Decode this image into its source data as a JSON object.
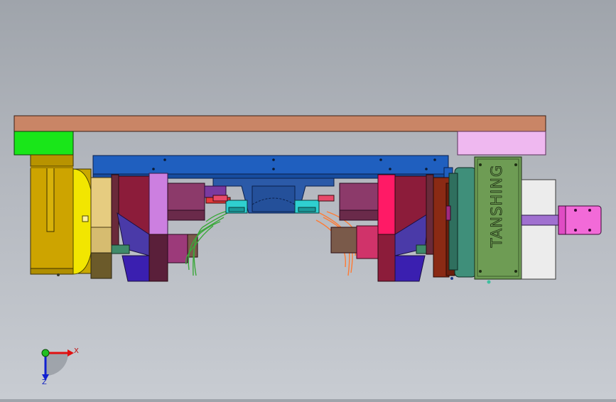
{
  "viewport": {
    "background_top": "#9fa4ab",
    "background_bottom": "#c8ccd2"
  },
  "model": {
    "brand_text": "TANSHING",
    "colors": {
      "top_plate": "#c98566",
      "green_block": "#19e619",
      "pink_block": "#efb8f0",
      "blue_beam": "#1f5fbf",
      "gold_drum": "#cda400",
      "yellow_ring": "#f2e600",
      "dark_red": "#8c1c3a",
      "magenta": "#ff1a66",
      "violet": "#cc7fe0",
      "indigo": "#3a1fb0",
      "green_motor": "#4f8f3f",
      "motor_body": "#6e9c54",
      "gray_block": "#ececec",
      "purple_shaft": "#a070d0",
      "pink_coupling": "#f26ad8",
      "teal_ring": "#3f8f7a",
      "orange_wire": "#ff7a33",
      "green_wire": "#3aa83a"
    }
  },
  "triad": {
    "x_label": "X",
    "z_label": "Z",
    "icon": "coordinate-triad-icon"
  }
}
